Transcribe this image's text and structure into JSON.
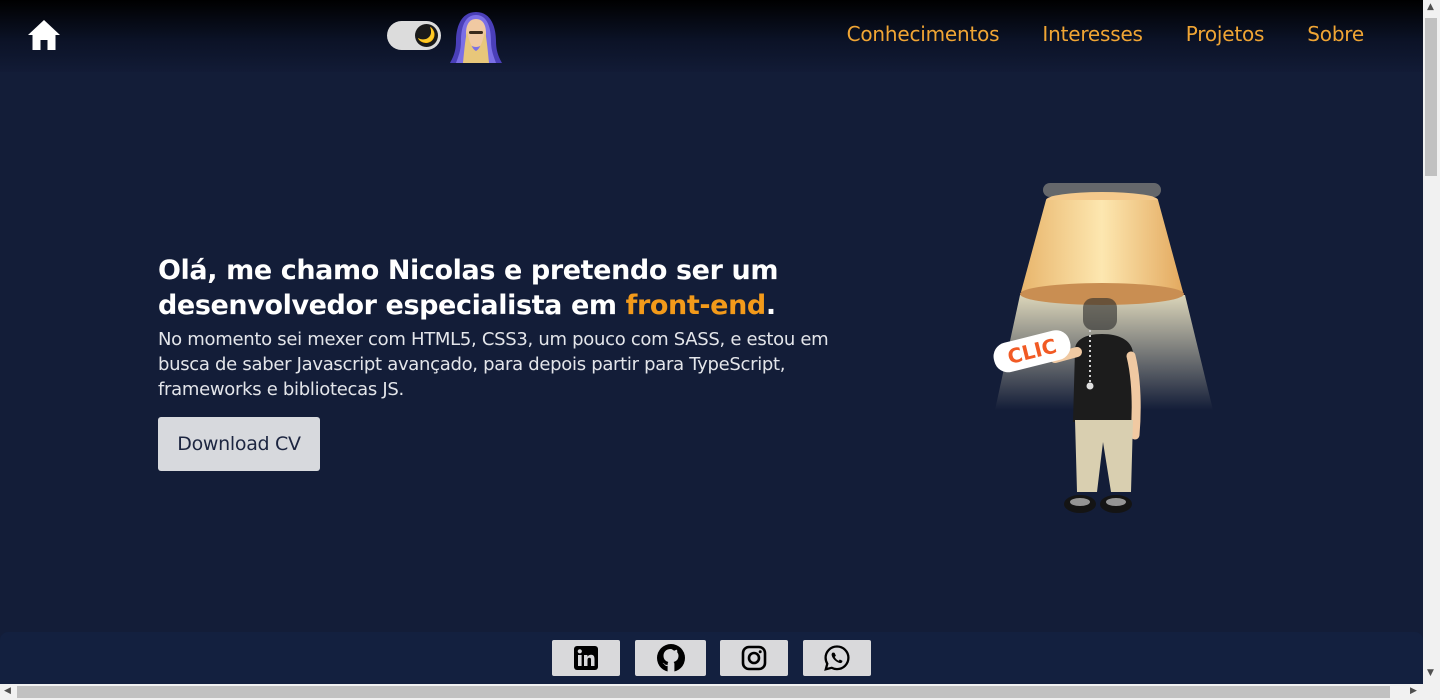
{
  "header": {
    "nav": [
      "Conhecimentos",
      "Interesses",
      "Projetos",
      "Sobre"
    ],
    "theme_toggle_icon": "moon-icon",
    "theme_toggle_glyph": "🌙"
  },
  "hero": {
    "title_line1": "Olá, me chamo Nicolas e pretendo ser um",
    "title_line2_pre": "desenvolvedor especialista em ",
    "title_accent": "front-end",
    "title_end": ".",
    "description": "No momento sei mexer com HTML5, CSS3, um pouco com SASS, e estou em busca de saber Javascript avançado, para depois partir para TypeScript, frameworks e bibliotecas JS.",
    "download_label": "Download CV",
    "lamp_sticker_text": "CLIC"
  },
  "footer": {
    "social": [
      "linkedin-icon",
      "github-icon",
      "instagram-icon",
      "whatsapp-icon"
    ]
  },
  "colors": {
    "accent": "#f39a1a",
    "nav": "#f0a534",
    "background": "#131d38"
  }
}
